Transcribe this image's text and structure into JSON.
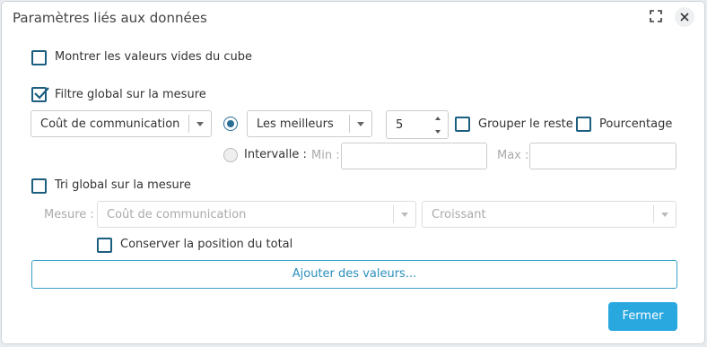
{
  "dialog": {
    "title": "Paramètres liés aux données"
  },
  "options": {
    "show_empty": {
      "label": "Montrer les valeurs vides du cube",
      "checked": false
    },
    "global_filter": {
      "label": "Filtre global sur la mesure",
      "checked": true
    },
    "global_sort": {
      "label": "Tri global sur la mesure",
      "checked": false
    },
    "keep_total": {
      "label": "Conserver la position du total",
      "checked": false
    }
  },
  "filter": {
    "measure": "Coût de communication",
    "mode_top": "Les meilleurs",
    "count": "5",
    "group_rest": "Grouper le reste",
    "percentage": "Pourcentage",
    "interval_label": "Intervalle :",
    "min_label": "Min :",
    "max_label": "Max :"
  },
  "sort": {
    "measure_label": "Mesure :",
    "measure": "Coût de communication",
    "order": "Croissant"
  },
  "buttons": {
    "add_values": "Ajouter des valeurs...",
    "close": "Fermer"
  },
  "colors": {
    "accent": "#29a7df",
    "checkbox": "#1b5e7f",
    "link": "#2b8fbd"
  }
}
